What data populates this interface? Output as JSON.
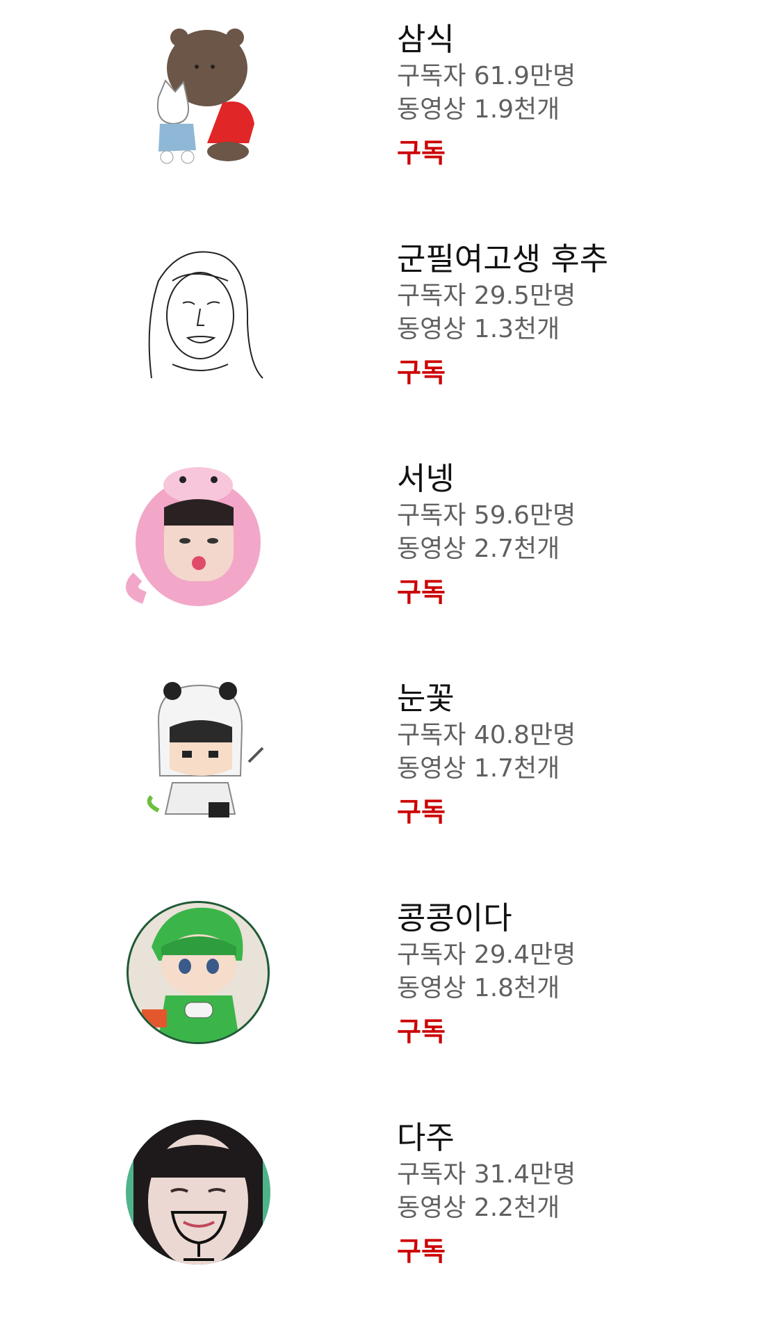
{
  "channels": [
    {
      "name": "삼식",
      "subscribers": "구독자 61.9만명",
      "videos": "동영상 1.9천개",
      "subscribe_label": "구독",
      "avatar_icon": "bear-and-cat-avatar-icon"
    },
    {
      "name": "군필여고생 후추",
      "subscribers": "구독자 29.5만명",
      "videos": "동영상 1.3천개",
      "subscribe_label": "구독",
      "avatar_icon": "line-drawing-face-avatar-icon"
    },
    {
      "name": "서넹",
      "subscribers": "구독자 59.6만명",
      "videos": "동영상 2.7천개",
      "subscribe_label": "구독",
      "avatar_icon": "pink-hood-girl-avatar-icon"
    },
    {
      "name": "눈꽃",
      "subscribers": "구독자 40.8만명",
      "videos": "동영상 1.7천개",
      "subscribe_label": "구독",
      "avatar_icon": "panda-hood-character-avatar-icon"
    },
    {
      "name": "콩콩이다",
      "subscribers": "구독자 29.4만명",
      "videos": "동영상 1.8천개",
      "subscribe_label": "구독",
      "avatar_icon": "green-hair-gamer-avatar-icon"
    },
    {
      "name": "다주",
      "subscribers": "구독자 31.4만명",
      "videos": "동영상 2.2천개",
      "subscribe_label": "구독",
      "avatar_icon": "girl-with-glass-drawing-avatar-icon"
    }
  ],
  "colors": {
    "subscribe": "#cc0000",
    "meta": "#606060",
    "name": "#111111",
    "avatar_ring": "#1f5a36"
  }
}
